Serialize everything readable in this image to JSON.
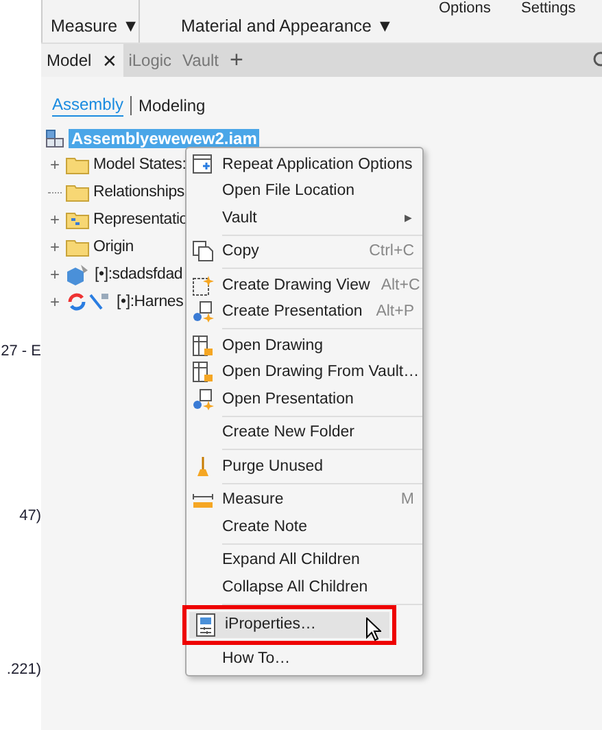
{
  "ribbon": {
    "groups": [
      {
        "label": "Measure ▼"
      },
      {
        "label": "Material and Appearance ▼"
      }
    ],
    "top_labels": [
      "Options",
      "Settings"
    ]
  },
  "side_fragments": [
    "27 - E",
    "47)",
    ".221)"
  ],
  "browser_tabs": [
    {
      "label": "Model",
      "selected": true,
      "close": "✕"
    },
    {
      "label": "iLogic",
      "selected": false
    },
    {
      "label": "Vault",
      "selected": false
    }
  ],
  "add_tab": "+",
  "view_switch": [
    {
      "label": "Assembly",
      "selected": true
    },
    {
      "label": "Modeling",
      "selected": false
    }
  ],
  "tree": {
    "label": "Assemblyewewew2.iam",
    "kind": "assembly",
    "selected": true,
    "children": [
      {
        "label": "Model States:",
        "kind": "folder",
        "expander": "+"
      },
      {
        "label": "Relationships",
        "kind": "folder"
      },
      {
        "label": "Representatio",
        "kind": "rep-folder",
        "expander": "+"
      },
      {
        "label": "Origin",
        "kind": "folder",
        "expander": "+"
      },
      {
        "label": "[•]:sdadsfdad",
        "kind": "part",
        "expander": "+"
      },
      {
        "label": "[•]:Harnes",
        "kind": "harness",
        "expander": "+"
      }
    ]
  },
  "context_menu": [
    {
      "kind": "item",
      "label": "Repeat Application Options",
      "highlighted": false
    },
    {
      "kind": "item",
      "label": "Open File Location",
      "highlighted": false
    },
    {
      "kind": "item",
      "label": "Vault",
      "arrow": "▶",
      "highlighted": false
    },
    {
      "kind": "separator"
    },
    {
      "kind": "item",
      "label": "Copy",
      "shortcut": "Ctrl+C",
      "highlighted": false
    },
    {
      "kind": "separator"
    },
    {
      "kind": "item",
      "label": "Create Drawing View",
      "shortcut": "Alt+C",
      "highlighted": false
    },
    {
      "kind": "item",
      "label": "Create Presentation",
      "shortcut": "Alt+P",
      "highlighted": false
    },
    {
      "kind": "separator"
    },
    {
      "kind": "item",
      "label": "Open Drawing",
      "highlighted": false
    },
    {
      "kind": "item",
      "label": "Open Drawing From Vault…",
      "highlighted": false
    },
    {
      "kind": "item",
      "label": "Open Presentation",
      "highlighted": false
    },
    {
      "kind": "separator"
    },
    {
      "kind": "item",
      "label": "Create New Folder",
      "highlighted": false
    },
    {
      "kind": "separator"
    },
    {
      "kind": "item",
      "label": "Purge Unused",
      "highlighted": false
    },
    {
      "kind": "separator"
    },
    {
      "kind": "item",
      "label": "Measure",
      "shortcut": "M",
      "highlighted": false
    },
    {
      "kind": "item",
      "label": "Create Note",
      "highlighted": false
    },
    {
      "kind": "separator"
    },
    {
      "kind": "item",
      "label": "Expand All Children",
      "highlighted": false
    },
    {
      "kind": "item",
      "label": "Collapse All Children",
      "highlighted": false
    },
    {
      "kind": "separator"
    },
    {
      "kind": "item",
      "label": "iProperties…",
      "highlighted": true
    },
    {
      "kind": "item",
      "label": "How To…",
      "highlighted": false
    }
  ]
}
